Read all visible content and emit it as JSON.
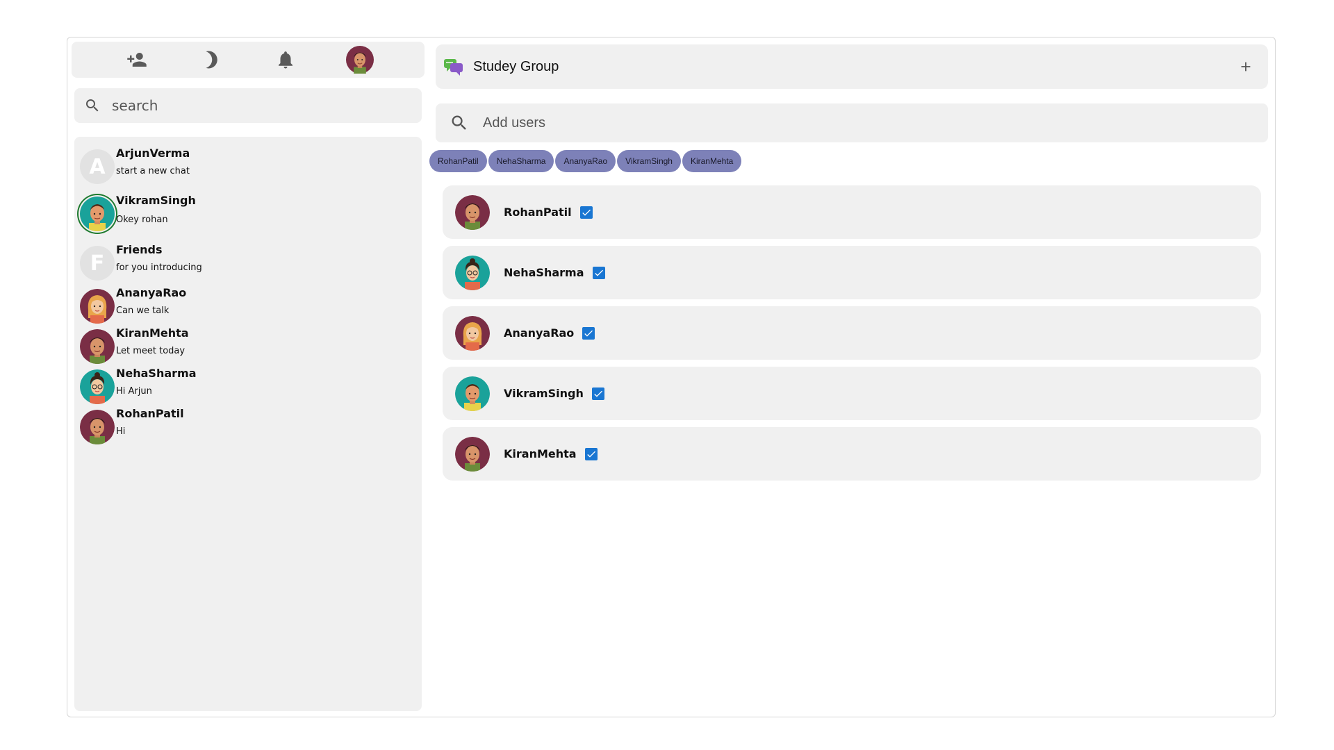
{
  "topbar": {
    "icons": [
      "add-person-icon",
      "dark-mode-icon",
      "notification-bell-icon",
      "profile-avatar"
    ]
  },
  "search": {
    "placeholder": "search"
  },
  "chats": [
    {
      "name": "ArjunVerma",
      "message": "start a new chat",
      "avatar": "letter",
      "letter": "A"
    },
    {
      "name": "VikramSingh",
      "message": "Okey rohan",
      "avatar": "teal-man"
    },
    {
      "name": "Friends",
      "message": "for you introducing",
      "avatar": "letter",
      "letter": "F"
    },
    {
      "name": "AnanyaRao",
      "message": "Can we talk",
      "avatar": "woman"
    },
    {
      "name": "KiranMehta",
      "message": "Let meet today",
      "avatar": "maroon-man"
    },
    {
      "name": "NehaSharma",
      "message": "Hi Arjun",
      "avatar": "teal-glasses"
    },
    {
      "name": "RohanPatil",
      "message": "Hi",
      "avatar": "maroon-man"
    }
  ],
  "group": {
    "title": "Studey Group",
    "icon": "chat-bubbles-icon",
    "add_icon": "plus-icon"
  },
  "add_users": {
    "placeholder": "Add users"
  },
  "chips": [
    "RohanPatil",
    "NehaSharma",
    "AnanyaRao",
    "VikramSingh",
    "KiranMehta"
  ],
  "members": [
    {
      "name": "RohanPatil",
      "avatar": "maroon-man",
      "checked": true
    },
    {
      "name": "NehaSharma",
      "avatar": "teal-glasses",
      "checked": true
    },
    {
      "name": "AnanyaRao",
      "avatar": "woman",
      "checked": true
    },
    {
      "name": "VikramSingh",
      "avatar": "teal-man",
      "checked": true
    },
    {
      "name": "KiranMehta",
      "avatar": "maroon-man",
      "checked": true
    }
  ],
  "colors": {
    "chip": "#7d81b8",
    "checkbox": "#1976d2",
    "panel": "#f0f0f0",
    "active_ring": "#1e7a2e"
  }
}
